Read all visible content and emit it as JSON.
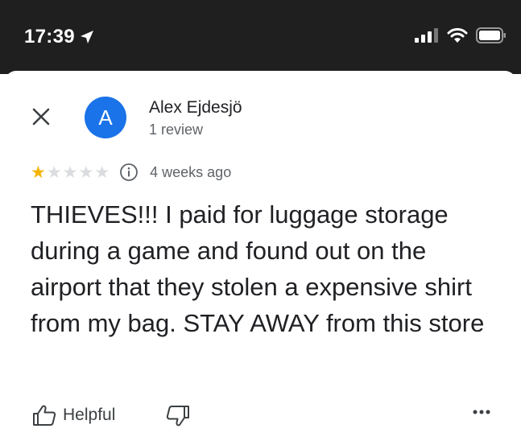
{
  "status_bar": {
    "time": "17:39",
    "icons": [
      "location-arrow-icon",
      "cellular-signal-icon",
      "wifi-icon",
      "battery-icon"
    ]
  },
  "review": {
    "reviewer_name": "Alex Ejdesjö",
    "avatar_letter": "A",
    "review_count": "1 review",
    "rating": 1,
    "rating_max": 5,
    "date": "4 weeks ago",
    "text": "THIEVES!!! I paid for luggage storage during a game and found out on the airport that they stolen a expensive shirt from my bag. STAY AWAY from this store"
  },
  "actions": {
    "helpful_label": "Helpful"
  },
  "colors": {
    "status_bar_bg": "#1f1f1f",
    "avatar_bg": "#1a73e8",
    "star_filled": "#f4b400",
    "star_empty": "#dadce0"
  }
}
